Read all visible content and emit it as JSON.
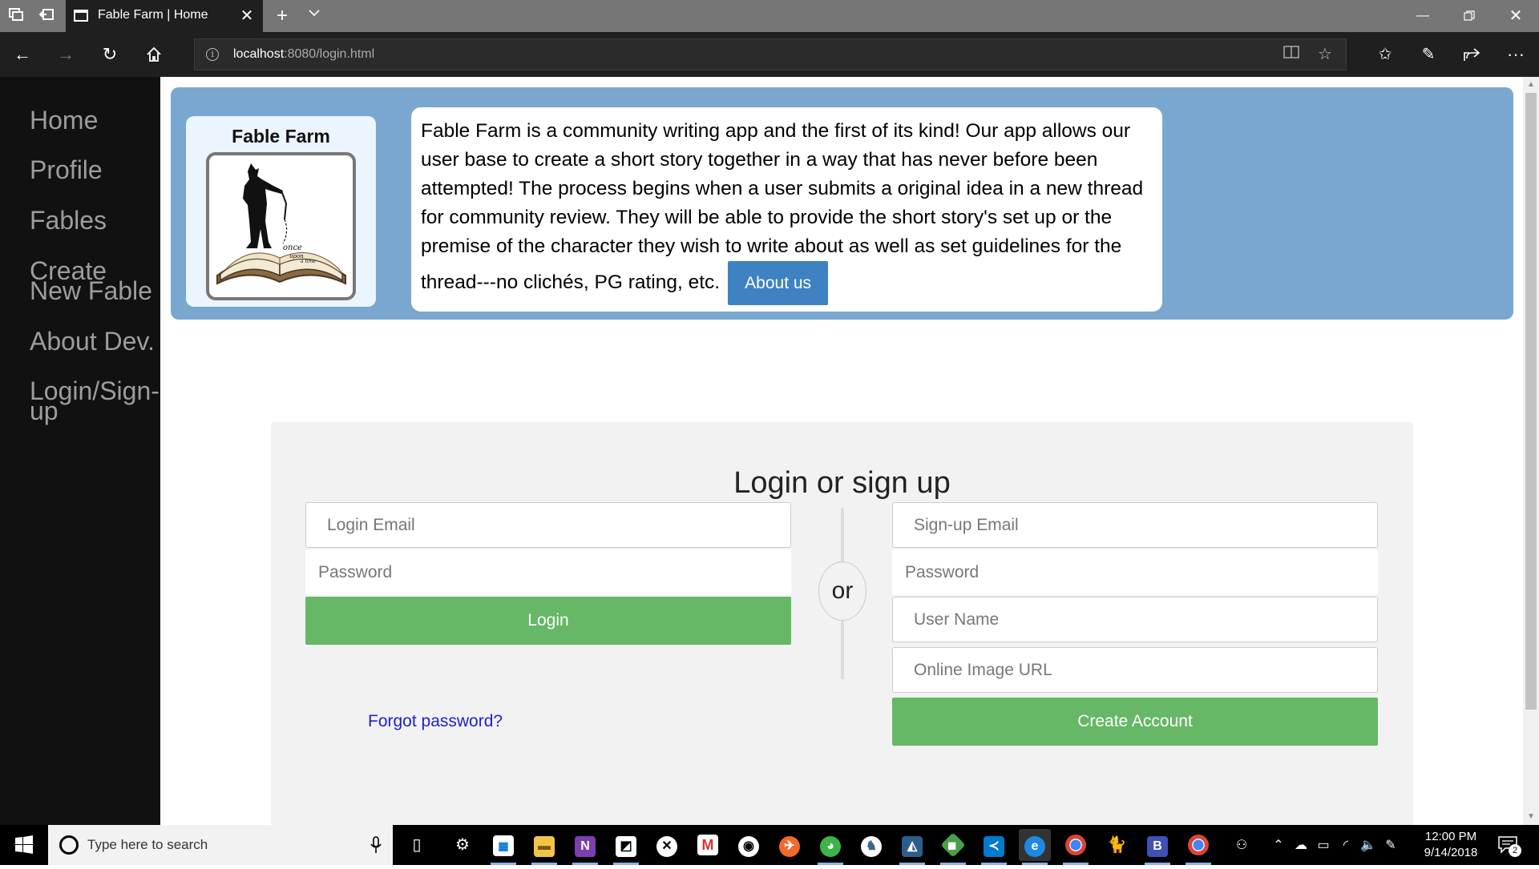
{
  "browser": {
    "tab_title": "Fable Farm | Home",
    "url_host": "localhost",
    "url_rest": ":8080/login.html"
  },
  "sidebar": {
    "items": [
      {
        "label": "Home"
      },
      {
        "label": "Profile"
      },
      {
        "label": "Fables"
      },
      {
        "label": "Create New Fable"
      },
      {
        "label": "About Dev."
      },
      {
        "label": "Login/Sign-up"
      }
    ]
  },
  "banner": {
    "app_name": "Fable Farm",
    "description": "Fable Farm is a community writing app and the first of its kind! Our app allows our user base to create a short story together in a way that has never before been attempted! The process begins when a user submits a original idea in a new thread for community review. They will be able to provide the short story's set up or the premise of the character they wish to write about as well as set guidelines for the thread---no clichés, PG rating, etc.",
    "about_button": "About us",
    "logo_text": "once upon a time"
  },
  "auth": {
    "heading": "Login or sign up",
    "separator": "or",
    "login": {
      "email_placeholder": "Login Email",
      "password_placeholder": "Password",
      "submit": "Login",
      "forgot": "Forgot password?"
    },
    "signup": {
      "email_placeholder": "Sign-up Email",
      "password_placeholder": "Password",
      "username_placeholder": "User Name",
      "image_placeholder": "Online Image URL",
      "submit": "Create Account"
    }
  },
  "taskbar": {
    "search_placeholder": "Type here to search",
    "time": "12:00 PM",
    "date": "9/14/2018",
    "notification_count": "2"
  },
  "colors": {
    "sidebar_bg": "#111111",
    "banner_bg": "#7aa7d0",
    "about_button": "#3e82c2",
    "green_button": "#66b766",
    "link": "#2020d0"
  }
}
